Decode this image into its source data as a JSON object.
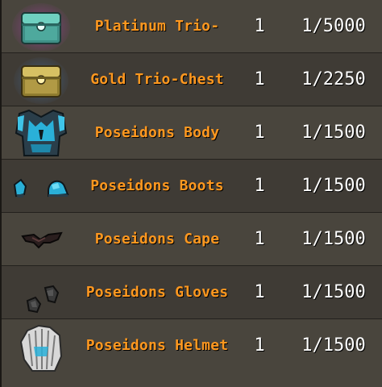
{
  "drops": [
    {
      "name": "Platinum Trio-Chest",
      "quantity": "1",
      "rarity": "1/5000",
      "icon": "platinum-chest-icon",
      "color": "#62c8b8"
    },
    {
      "name": "Gold Trio-Chest",
      "quantity": "1",
      "rarity": "1/2250",
      "icon": "gold-chest-icon",
      "color": "#c9b14e"
    },
    {
      "name": "Poseidons Body",
      "quantity": "1",
      "rarity": "1/1500",
      "icon": "poseidons-body-icon",
      "color": "#2ab0d8"
    },
    {
      "name": "Poseidons Boots",
      "quantity": "1",
      "rarity": "1/1500",
      "icon": "poseidons-boots-icon",
      "color": "#2ab0d8"
    },
    {
      "name": "Poseidons Cape",
      "quantity": "1",
      "rarity": "1/1500",
      "icon": "poseidons-cape-icon",
      "color": "#3a2a2a"
    },
    {
      "name": "Poseidons Gloves",
      "quantity": "1",
      "rarity": "1/1500",
      "icon": "poseidons-gloves-icon",
      "color": "#3a3a3a"
    },
    {
      "name": "Poseidons Helmet",
      "quantity": "1",
      "rarity": "1/1500",
      "icon": "poseidons-helmet-icon",
      "color": "#d8d8d8"
    }
  ]
}
